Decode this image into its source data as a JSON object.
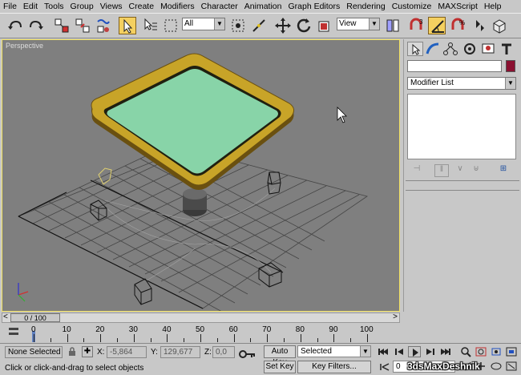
{
  "menu": [
    "File",
    "Edit",
    "Tools",
    "Group",
    "Views",
    "Create",
    "Modifiers",
    "Character",
    "Animation",
    "Graph Editors",
    "Rendering",
    "Customize",
    "MAXScript",
    "Help"
  ],
  "toolbar": {
    "selection_filter": "All",
    "ref_coord": "View",
    "icons": [
      "undo-icon",
      "redo-icon",
      "select-and-link-icon",
      "unlink-icon",
      "bind-space-warp-icon",
      "select-object-icon",
      "select-by-name-icon",
      "rectangular-selection-icon",
      "selection-filter-dropdown",
      "window-crossing-icon",
      "select-and-move-icon",
      "select-and-rotate-icon",
      "select-and-scale-icon",
      "reference-coordinate-dropdown",
      "use-pivot-center-icon",
      "angle-snap-icon",
      "snaps-toggle-icon",
      "percent-snap-icon",
      "spinner-snap-icon",
      "quick-render-icon"
    ]
  },
  "viewport": {
    "label": "Perspective"
  },
  "command_panel": {
    "tabs": [
      "create-tab",
      "modify-tab",
      "hierarchy-tab",
      "motion-tab",
      "display-tab",
      "utilities-tab"
    ],
    "modifier_list": "Modifier List",
    "object_color": "#8a1030"
  },
  "timeline": {
    "slider": "0 / 100",
    "labels": [
      "0",
      "10",
      "20",
      "30",
      "40",
      "50",
      "60",
      "70",
      "80",
      "90",
      "100"
    ]
  },
  "status": {
    "selection": "None Selected",
    "x_label": "X:",
    "x_value": "-5,864",
    "y_label": "Y:",
    "y_value": "129,677",
    "z_label": "Z:",
    "z_value": "0,0",
    "auto_key": "Auto Key",
    "set_key": "Set Key",
    "key_mode": "Selected",
    "key_filters": "Key Filters...",
    "frame": "0",
    "prompt": "Click or click-and-drag to select objects"
  },
  "watermark": "3dsMaxDeshnik",
  "colors": {
    "viewport_bg": "#7f7f7f",
    "table_top": "#88d4a8",
    "table_rim": "#c8a428",
    "active_tool": "#f4d060"
  }
}
